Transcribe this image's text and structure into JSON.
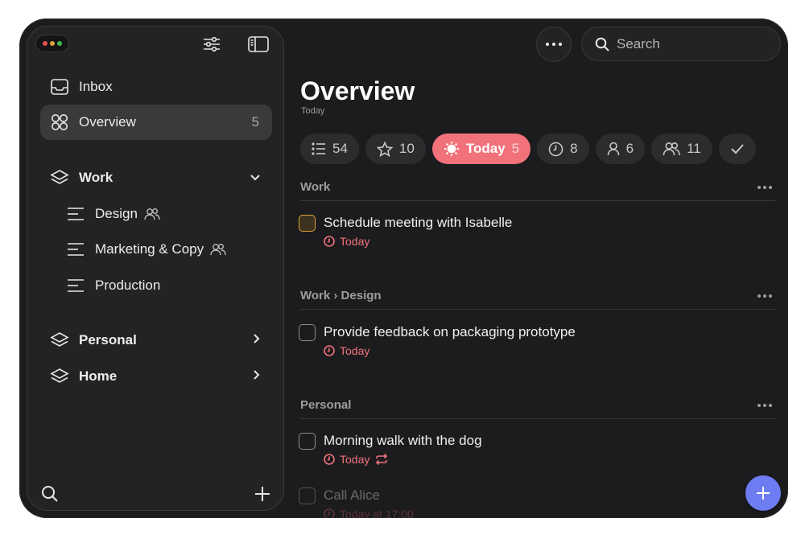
{
  "colors": {
    "accent": "#f2727b",
    "fab": "#6d7cf0",
    "highlight_checkbox": "#d9a23a",
    "window_close": "#e5534b",
    "window_minimize": "#d9a23a",
    "window_zoom": "#3fb950"
  },
  "sidebar": {
    "items": [
      {
        "label": "Inbox",
        "icon": "inbox-icon"
      },
      {
        "label": "Overview",
        "icon": "overview-grid-icon",
        "count": "5",
        "active": true
      }
    ],
    "areas": [
      {
        "label": "Work",
        "icon": "layers-icon",
        "expanded": true,
        "lists": [
          {
            "label": "Design",
            "shared": true
          },
          {
            "label": "Marketing & Copy",
            "shared": true
          },
          {
            "label": "Production",
            "shared": false
          }
        ]
      },
      {
        "label": "Personal",
        "icon": "layers-icon",
        "expanded": false
      },
      {
        "label": "Home",
        "icon": "layers-icon",
        "expanded": false
      }
    ]
  },
  "header": {
    "search_placeholder": "Search",
    "title": "Overview",
    "subtitle": "Today"
  },
  "filters": [
    {
      "icon": "list-icon",
      "count": "54"
    },
    {
      "icon": "star-icon",
      "count": "10"
    },
    {
      "icon": "sun-icon",
      "label": "Today",
      "count": "5",
      "active": true
    },
    {
      "icon": "clock-icon",
      "count": "8"
    },
    {
      "icon": "person-icon",
      "count": "6"
    },
    {
      "icon": "people-icon",
      "count": "11"
    },
    {
      "icon": "checkmark-icon"
    }
  ],
  "sections": [
    {
      "title": "Work",
      "tasks": [
        {
          "title": "Schedule meeting with Isabelle",
          "due": "Today",
          "highlighted": true
        }
      ]
    },
    {
      "title": "Work › Design",
      "tasks": [
        {
          "title": "Provide feedback on packaging prototype",
          "due": "Today"
        }
      ]
    },
    {
      "title": "Personal",
      "tasks": [
        {
          "title": "Morning walk with the dog",
          "due": "Today",
          "repeat": true
        },
        {
          "title": "Call Alice",
          "due": "Today at 17:00",
          "faded": true
        }
      ]
    }
  ]
}
